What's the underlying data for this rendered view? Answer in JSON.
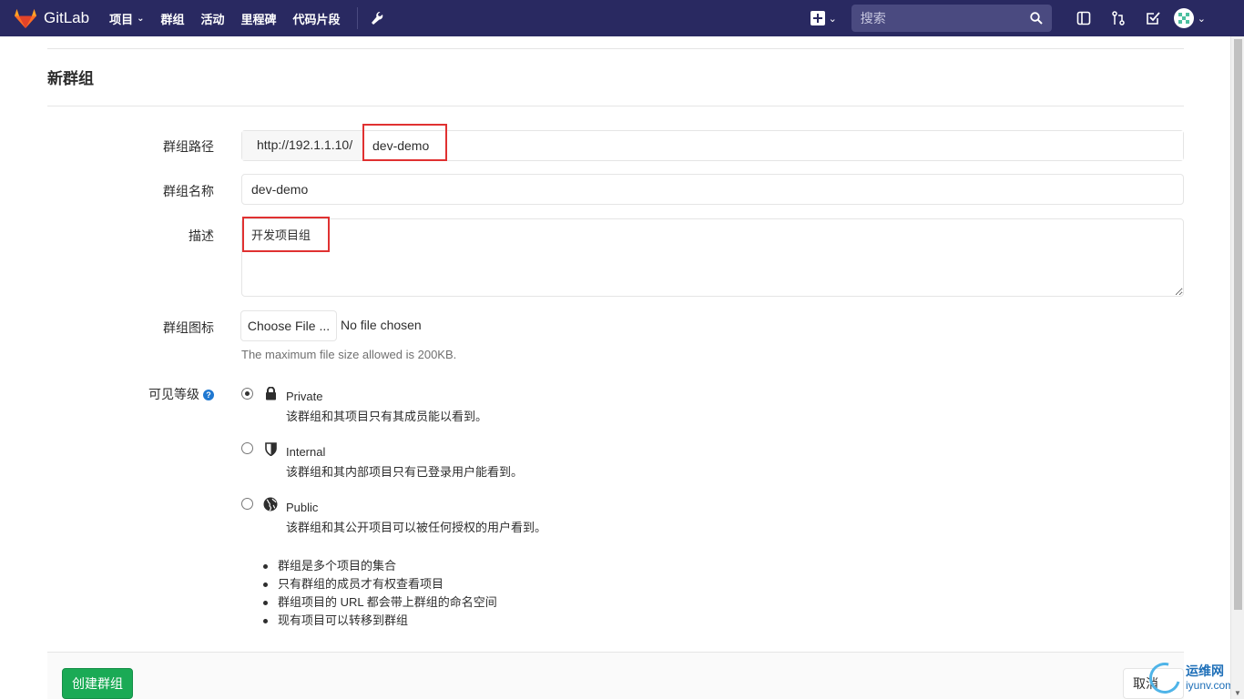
{
  "navbar": {
    "brand": "GitLab",
    "links": [
      {
        "label": "项目",
        "dropdown": true
      },
      {
        "label": "群组",
        "dropdown": false
      },
      {
        "label": "活动",
        "dropdown": false
      },
      {
        "label": "里程碑",
        "dropdown": false
      },
      {
        "label": "代码片段",
        "dropdown": false
      }
    ],
    "search_placeholder": "搜索",
    "icons": [
      "plus-square-icon",
      "sidebar-toggle-icon",
      "merge-request-icon",
      "todo-icon",
      "avatar-icon"
    ],
    "bg_color": "#292961"
  },
  "page": {
    "title": "新群组"
  },
  "form": {
    "path_label": "群组路径",
    "path_prefix": "http://192.1.1.10/",
    "path_value": "dev-demo",
    "name_label": "群组名称",
    "name_value": "dev-demo",
    "description_label": "描述",
    "description_value": "开发项目组",
    "avatar_label": "群组图标",
    "choose_file": "Choose File ...",
    "file_status": "No file chosen",
    "file_help": "The maximum file size allowed is 200KB.",
    "visibility_label": "可见等级",
    "visibility_help_glyph": "?",
    "visibility_options": [
      {
        "name": "Private",
        "description": "该群组和其项目只有其成员能以看到。",
        "checked": true,
        "icon": "lock-icon"
      },
      {
        "name": "Internal",
        "description": "该群组和其内部项目只有已登录用户能看到。",
        "checked": false,
        "icon": "shield-icon"
      },
      {
        "name": "Public",
        "description": "该群组和其公开项目可以被任何授权的用户看到。",
        "checked": false,
        "icon": "globe-icon"
      }
    ],
    "notes": [
      "群组是多个项目的集合",
      "只有群组的成员才有权查看项目",
      "群组项目的 URL 都会带上群组的命名空间",
      "现有项目可以转移到群组"
    ],
    "create_button": "创建群组",
    "cancel_button": "取消"
  },
  "watermark": {
    "cn": "运维网",
    "en": "iyunv.com"
  },
  "colors": {
    "accent_green": "#1aaa55",
    "highlight_red": "#e03131",
    "link_blue": "#1f78d1"
  }
}
